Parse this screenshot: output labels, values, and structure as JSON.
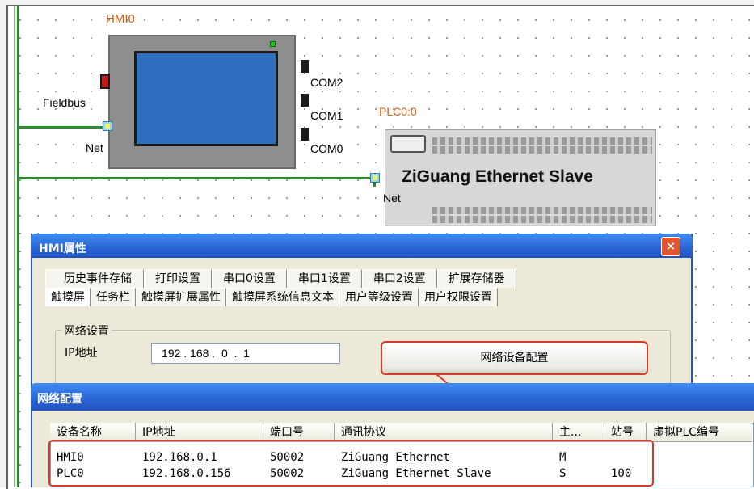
{
  "canvas": {
    "hmi": {
      "label": "HMI0",
      "ports": {
        "fieldbus": "Fieldbus",
        "net": "Net",
        "com2": "COM2",
        "com1": "COM1",
        "com0": "COM0"
      }
    },
    "plc": {
      "label": "PLC0:0",
      "name": "ZiGuang Ethernet Slave",
      "net": "Net"
    }
  },
  "hmi_dialog": {
    "title": "HMI属性",
    "close": "✕",
    "tabs_row1": [
      "历史事件存储",
      "打印设置",
      "串口0设置",
      "串口1设置",
      "串口2设置",
      "扩展存储器"
    ],
    "tabs_row2": [
      "触摸屏",
      "任务栏",
      "触摸屏扩展属性",
      "触摸屏系统信息文本",
      "用户等级设置",
      "用户权限设置"
    ],
    "group_label": "网络设置",
    "ip_label": "IP地址",
    "ip_value": "192 . 168 .  0  .  1",
    "net_button": "网络设备配置"
  },
  "net_dialog": {
    "title": "网络配置",
    "columns": [
      "设备名称",
      "IP地址",
      "端口号",
      "通讯协议",
      "主...",
      "站号",
      "虚拟PLC编号"
    ],
    "rows": [
      [
        "HMI0",
        "192.168.0.1",
        "50002",
        "ZiGuang Ethernet",
        "M",
        ""
      ],
      [
        "PLC0",
        "192.168.0.156",
        "50002",
        "ZiGuang Ethernet Slave",
        "S",
        "100"
      ]
    ]
  },
  "colors": {
    "wire": "#2e8b2e",
    "label_orange": "#e05a10",
    "highlight": "#d63a2c",
    "title_blue": "#2a63d4"
  }
}
